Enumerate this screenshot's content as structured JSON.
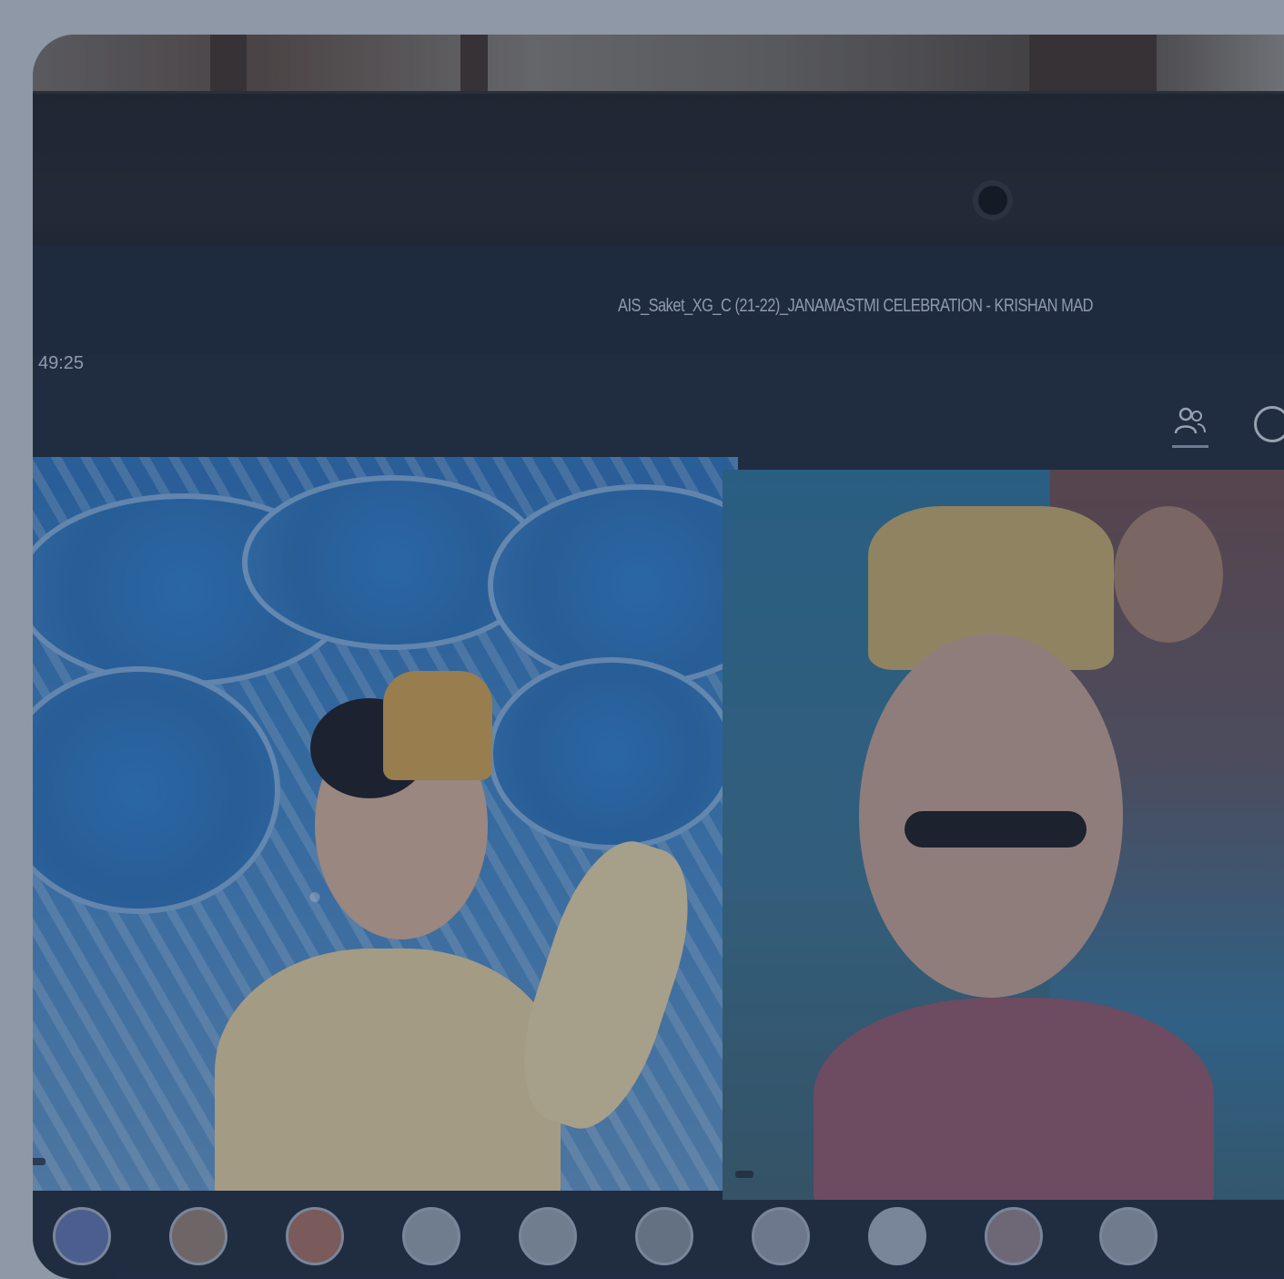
{
  "meeting": {
    "title": "AIS_Saket_XG_C (21-22)_JANAMASTMI CELEBRATION - KRISHAN MAD",
    "timer": "49:25"
  },
  "toolbar": {
    "participants_icon": "people-icon",
    "chat_icon": "chat-icon"
  },
  "tiles": {
    "left_name": "",
    "right_name": ""
  },
  "participants": [
    {
      "icon": "avatar-initials"
    },
    {
      "icon": "avatar-photo"
    },
    {
      "icon": "avatar-photo"
    },
    {
      "icon": "avatar-initials"
    },
    {
      "icon": "avatar-initials"
    },
    {
      "icon": "avatar-photo"
    },
    {
      "icon": "avatar-photo"
    },
    {
      "icon": "avatar-initials"
    },
    {
      "icon": "avatar-photo"
    },
    {
      "icon": "avatar-photo"
    }
  ],
  "colors": {
    "teams_bg": "#1f2a3a",
    "overlay": "#243250"
  }
}
